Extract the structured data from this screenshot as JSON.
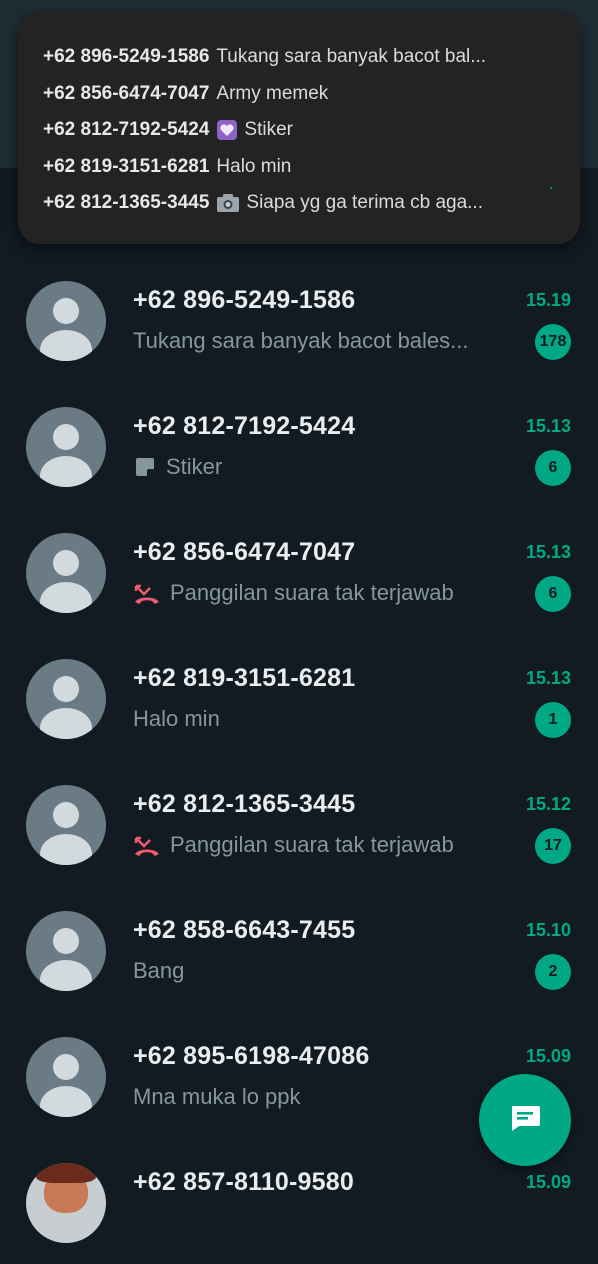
{
  "colors": {
    "accent": "#00a884",
    "background": "#121b22",
    "missed_call": "#f15c6d"
  },
  "notification": {
    "lines": [
      {
        "sender": "+62 896-5249-1586",
        "message": "Tukang sara banyak bacot bal...",
        "icon": ""
      },
      {
        "sender": "+62 856-6474-7047",
        "message": "Army memek",
        "icon": ""
      },
      {
        "sender": "+62 812-7192-5424",
        "message": "Stiker",
        "icon": "purple-heart-icon"
      },
      {
        "sender": "+62 819-3151-6281",
        "message": "Halo min",
        "icon": ""
      },
      {
        "sender": "+62 812-1365-3445",
        "message": "Siapa yg ga terima cb aga...",
        "icon": "camera-icon"
      }
    ]
  },
  "chats": [
    {
      "name": "+62 896-5249-1586",
      "preview": "Tukang sara banyak bacot bales...",
      "time": "15.19",
      "unread": "178",
      "preview_icon": ""
    },
    {
      "name": "+62 812-7192-5424",
      "preview": "Stiker",
      "time": "15.13",
      "unread": "6",
      "preview_icon": "sticker-icon"
    },
    {
      "name": "+62 856-6474-7047",
      "preview": "Panggilan suara tak terjawab",
      "time": "15.13",
      "unread": "6",
      "preview_icon": "missed-call-icon"
    },
    {
      "name": "+62 819-3151-6281",
      "preview": "Halo min",
      "time": "15.13",
      "unread": "1",
      "preview_icon": ""
    },
    {
      "name": "+62 812-1365-3445",
      "preview": "Panggilan suara tak terjawab",
      "time": "15.12",
      "unread": "17",
      "preview_icon": "missed-call-icon"
    },
    {
      "name": "+62 858-6643-7455",
      "preview": "Bang",
      "time": "15.10",
      "unread": "2",
      "preview_icon": ""
    },
    {
      "name": "+62 895-6198-47086",
      "preview": "Mna muka lo ppk",
      "time": "15.09",
      "unread": "",
      "preview_icon": ""
    },
    {
      "name": "+62 857-8110-9580",
      "preview": "",
      "time": "15.09",
      "unread": "",
      "preview_icon": ""
    }
  ],
  "fab": {
    "icon": "new-chat-icon"
  }
}
